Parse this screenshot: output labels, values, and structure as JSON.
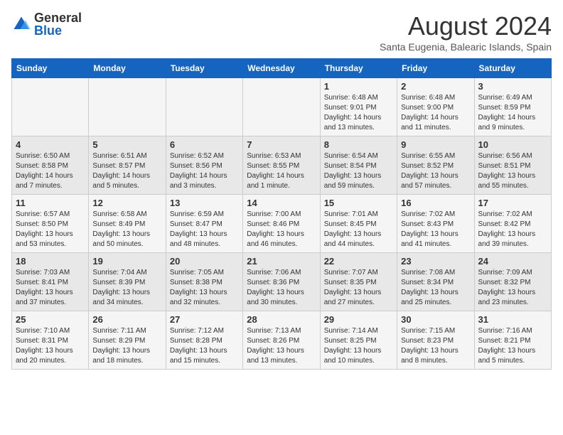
{
  "logo": {
    "general": "General",
    "blue": "Blue"
  },
  "header": {
    "month": "August 2024",
    "location": "Santa Eugenia, Balearic Islands, Spain"
  },
  "days_of_week": [
    "Sunday",
    "Monday",
    "Tuesday",
    "Wednesday",
    "Thursday",
    "Friday",
    "Saturday"
  ],
  "weeks": [
    [
      {
        "day": "",
        "info": ""
      },
      {
        "day": "",
        "info": ""
      },
      {
        "day": "",
        "info": ""
      },
      {
        "day": "",
        "info": ""
      },
      {
        "day": "1",
        "info": "Sunrise: 6:48 AM\nSunset: 9:01 PM\nDaylight: 14 hours\nand 13 minutes."
      },
      {
        "day": "2",
        "info": "Sunrise: 6:48 AM\nSunset: 9:00 PM\nDaylight: 14 hours\nand 11 minutes."
      },
      {
        "day": "3",
        "info": "Sunrise: 6:49 AM\nSunset: 8:59 PM\nDaylight: 14 hours\nand 9 minutes."
      }
    ],
    [
      {
        "day": "4",
        "info": "Sunrise: 6:50 AM\nSunset: 8:58 PM\nDaylight: 14 hours\nand 7 minutes."
      },
      {
        "day": "5",
        "info": "Sunrise: 6:51 AM\nSunset: 8:57 PM\nDaylight: 14 hours\nand 5 minutes."
      },
      {
        "day": "6",
        "info": "Sunrise: 6:52 AM\nSunset: 8:56 PM\nDaylight: 14 hours\nand 3 minutes."
      },
      {
        "day": "7",
        "info": "Sunrise: 6:53 AM\nSunset: 8:55 PM\nDaylight: 14 hours\nand 1 minute."
      },
      {
        "day": "8",
        "info": "Sunrise: 6:54 AM\nSunset: 8:54 PM\nDaylight: 13 hours\nand 59 minutes."
      },
      {
        "day": "9",
        "info": "Sunrise: 6:55 AM\nSunset: 8:52 PM\nDaylight: 13 hours\nand 57 minutes."
      },
      {
        "day": "10",
        "info": "Sunrise: 6:56 AM\nSunset: 8:51 PM\nDaylight: 13 hours\nand 55 minutes."
      }
    ],
    [
      {
        "day": "11",
        "info": "Sunrise: 6:57 AM\nSunset: 8:50 PM\nDaylight: 13 hours\nand 53 minutes."
      },
      {
        "day": "12",
        "info": "Sunrise: 6:58 AM\nSunset: 8:49 PM\nDaylight: 13 hours\nand 50 minutes."
      },
      {
        "day": "13",
        "info": "Sunrise: 6:59 AM\nSunset: 8:47 PM\nDaylight: 13 hours\nand 48 minutes."
      },
      {
        "day": "14",
        "info": "Sunrise: 7:00 AM\nSunset: 8:46 PM\nDaylight: 13 hours\nand 46 minutes."
      },
      {
        "day": "15",
        "info": "Sunrise: 7:01 AM\nSunset: 8:45 PM\nDaylight: 13 hours\nand 44 minutes."
      },
      {
        "day": "16",
        "info": "Sunrise: 7:02 AM\nSunset: 8:43 PM\nDaylight: 13 hours\nand 41 minutes."
      },
      {
        "day": "17",
        "info": "Sunrise: 7:02 AM\nSunset: 8:42 PM\nDaylight: 13 hours\nand 39 minutes."
      }
    ],
    [
      {
        "day": "18",
        "info": "Sunrise: 7:03 AM\nSunset: 8:41 PM\nDaylight: 13 hours\nand 37 minutes."
      },
      {
        "day": "19",
        "info": "Sunrise: 7:04 AM\nSunset: 8:39 PM\nDaylight: 13 hours\nand 34 minutes."
      },
      {
        "day": "20",
        "info": "Sunrise: 7:05 AM\nSunset: 8:38 PM\nDaylight: 13 hours\nand 32 minutes."
      },
      {
        "day": "21",
        "info": "Sunrise: 7:06 AM\nSunset: 8:36 PM\nDaylight: 13 hours\nand 30 minutes."
      },
      {
        "day": "22",
        "info": "Sunrise: 7:07 AM\nSunset: 8:35 PM\nDaylight: 13 hours\nand 27 minutes."
      },
      {
        "day": "23",
        "info": "Sunrise: 7:08 AM\nSunset: 8:34 PM\nDaylight: 13 hours\nand 25 minutes."
      },
      {
        "day": "24",
        "info": "Sunrise: 7:09 AM\nSunset: 8:32 PM\nDaylight: 13 hours\nand 23 minutes."
      }
    ],
    [
      {
        "day": "25",
        "info": "Sunrise: 7:10 AM\nSunset: 8:31 PM\nDaylight: 13 hours\nand 20 minutes."
      },
      {
        "day": "26",
        "info": "Sunrise: 7:11 AM\nSunset: 8:29 PM\nDaylight: 13 hours\nand 18 minutes."
      },
      {
        "day": "27",
        "info": "Sunrise: 7:12 AM\nSunset: 8:28 PM\nDaylight: 13 hours\nand 15 minutes."
      },
      {
        "day": "28",
        "info": "Sunrise: 7:13 AM\nSunset: 8:26 PM\nDaylight: 13 hours\nand 13 minutes."
      },
      {
        "day": "29",
        "info": "Sunrise: 7:14 AM\nSunset: 8:25 PM\nDaylight: 13 hours\nand 10 minutes."
      },
      {
        "day": "30",
        "info": "Sunrise: 7:15 AM\nSunset: 8:23 PM\nDaylight: 13 hours\nand 8 minutes."
      },
      {
        "day": "31",
        "info": "Sunrise: 7:16 AM\nSunset: 8:21 PM\nDaylight: 13 hours\nand 5 minutes."
      }
    ]
  ]
}
